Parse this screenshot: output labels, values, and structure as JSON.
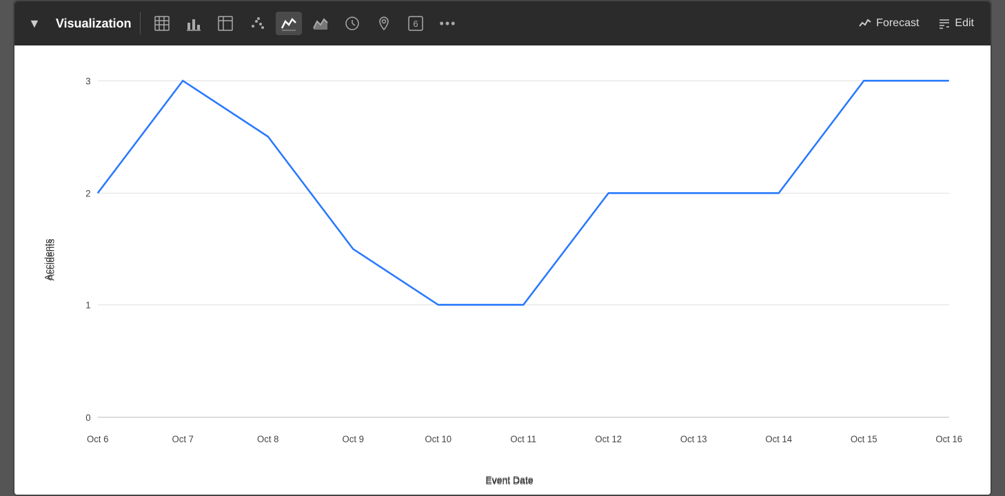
{
  "toolbar": {
    "collapse_icon": "▼",
    "title": "Visualization",
    "icons": [
      {
        "name": "table-icon",
        "symbol": "⊞",
        "active": false
      },
      {
        "name": "bar-chart-icon",
        "symbol": "▐",
        "active": false
      },
      {
        "name": "table-alt-icon",
        "symbol": "≡",
        "active": false
      },
      {
        "name": "scatter-icon",
        "symbol": "⁘",
        "active": false
      },
      {
        "name": "line-chart-icon",
        "symbol": "📈",
        "active": true
      },
      {
        "name": "area-chart-icon",
        "symbol": "📉",
        "active": false
      },
      {
        "name": "clock-icon",
        "symbol": "🕐",
        "active": false
      },
      {
        "name": "pin-icon",
        "symbol": "📍",
        "active": false
      },
      {
        "name": "number-icon",
        "symbol": "6",
        "active": false
      },
      {
        "name": "more-icon",
        "symbol": "•••",
        "active": false
      }
    ],
    "forecast_label": "Forecast",
    "edit_label": "Edit"
  },
  "chart": {
    "y_axis_label": "Accidents",
    "x_axis_label": "Event Date",
    "y_ticks": [
      0,
      1,
      2,
      3
    ],
    "x_labels": [
      "Oct 6",
      "Oct 7",
      "Oct 8",
      "Oct 9",
      "Oct 10",
      "Oct 11",
      "Oct 12",
      "Oct 13",
      "Oct 14",
      "Oct 15",
      "Oct 16"
    ],
    "data_points": [
      {
        "date": "Oct 6",
        "value": 2
      },
      {
        "date": "Oct 7",
        "value": 3
      },
      {
        "date": "Oct 8",
        "value": 2.5
      },
      {
        "date": "Oct 9",
        "value": 1.5
      },
      {
        "date": "Oct 10",
        "value": 1
      },
      {
        "date": "Oct 11",
        "value": 1
      },
      {
        "date": "Oct 12",
        "value": 2
      },
      {
        "date": "Oct 13",
        "value": 2
      },
      {
        "date": "Oct 14",
        "value": 2
      },
      {
        "date": "Oct 15",
        "value": 3
      },
      {
        "date": "Oct 16",
        "value": 3
      }
    ]
  }
}
